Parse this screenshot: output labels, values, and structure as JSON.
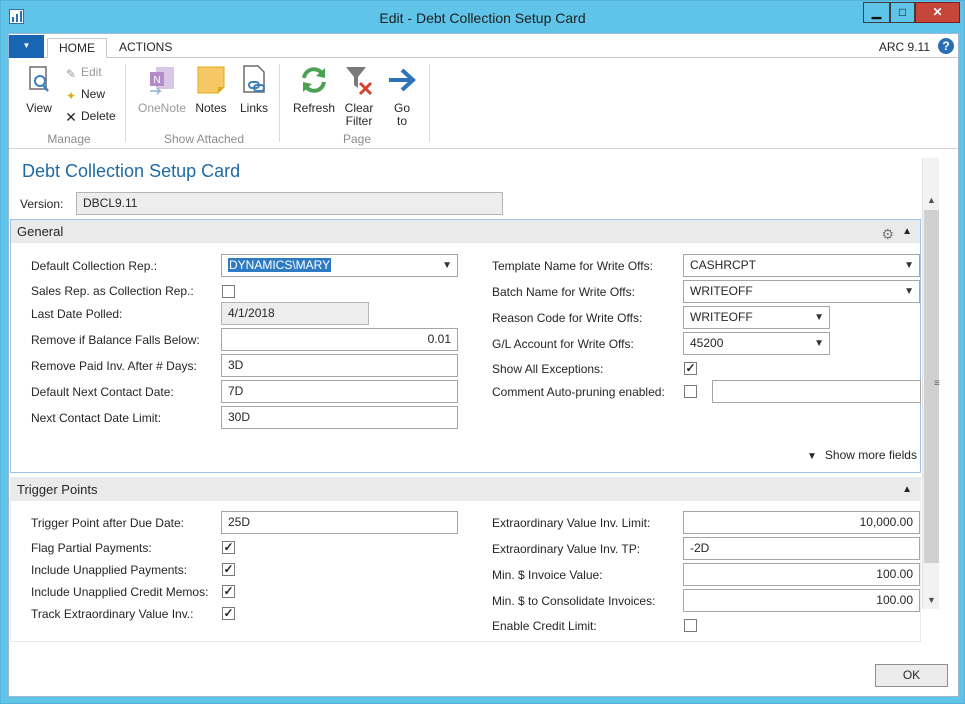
{
  "window": {
    "title": "Edit - Debt Collection Setup Card",
    "minimize_label": "▁",
    "maximize_label": "□",
    "close_label": "✕"
  },
  "tabs": [
    {
      "label": "HOME"
    },
    {
      "label": "ACTIONS"
    }
  ],
  "company": "ARC 9.11",
  "help_label": "?",
  "ribbon": {
    "manage": {
      "label": "Manage",
      "view": "View",
      "edit": "Edit",
      "new": "New",
      "delete": "Delete"
    },
    "show_attached": {
      "label": "Show Attached",
      "onenote": "OneNote",
      "notes": "Notes",
      "links": "Links"
    },
    "page": {
      "label": "Page",
      "refresh": "Refresh",
      "clear_filter_1": "Clear",
      "clear_filter_2": "Filter",
      "goto_1": "Go",
      "goto_2": "to"
    }
  },
  "page_title": "Debt Collection Setup Card",
  "version": {
    "label": "Version:",
    "value": "DBCL9.11"
  },
  "general": {
    "header": "General",
    "default_collection_rep": {
      "label": "Default Collection Rep.:",
      "value": "DYNAMICS\\MARY"
    },
    "sales_rep_as_collection_rep": {
      "label": "Sales Rep. as Collection Rep.:",
      "checked": false
    },
    "last_date_polled": {
      "label": "Last Date Polled:",
      "value": "4/1/2018"
    },
    "remove_if_balance": {
      "label": "Remove if Balance Falls Below:",
      "value": "0.01"
    },
    "remove_paid_inv": {
      "label": "Remove Paid Inv. After # Days:",
      "value": "3D"
    },
    "default_next_contact": {
      "label": "Default Next Contact Date:",
      "value": "7D"
    },
    "next_contact_limit": {
      "label": "Next Contact Date Limit:",
      "value": "30D"
    },
    "template_name": {
      "label": "Template Name for Write Offs:",
      "value": "CASHRCPT"
    },
    "batch_name": {
      "label": "Batch Name for Write Offs:",
      "value": "WRITEOFF"
    },
    "reason_code": {
      "label": "Reason Code for Write Offs:",
      "value": "WRITEOFF"
    },
    "gl_account": {
      "label": "G/L Account for Write Offs:",
      "value": "45200"
    },
    "show_all_exceptions": {
      "label": "Show All Exceptions:",
      "checked": true
    },
    "comment_auto_pruning": {
      "label": "Comment Auto-pruning enabled:",
      "checked": false,
      "value": ""
    },
    "show_more": "Show more fields"
  },
  "trigger_points": {
    "header": "Trigger Points",
    "trigger_after_due": {
      "label": "Trigger Point after Due Date:",
      "value": "25D"
    },
    "flag_partial": {
      "label": "Flag Partial Payments:",
      "checked": true
    },
    "include_unapplied_payments": {
      "label": "Include Unapplied Payments:",
      "checked": true
    },
    "include_unapplied_credit": {
      "label": "Include Unapplied Credit Memos:",
      "checked": true
    },
    "track_extraordinary": {
      "label": "Track Extraordinary Value Inv.:",
      "checked": true
    },
    "extraordinary_limit": {
      "label": "Extraordinary Value Inv. Limit:",
      "value": "10,000.00"
    },
    "extraordinary_tp": {
      "label": "Extraordinary Value Inv. TP:",
      "value": "-2D"
    },
    "min_invoice_value": {
      "label": "Min. $ Invoice Value:",
      "value": "100.00"
    },
    "min_consolidate": {
      "label": "Min. $ to Consolidate Invoices:",
      "value": "100.00"
    },
    "enable_credit_limit": {
      "label": "Enable Credit Limit:",
      "checked": false
    }
  },
  "ok_button": "OK",
  "check_mark": "✓"
}
